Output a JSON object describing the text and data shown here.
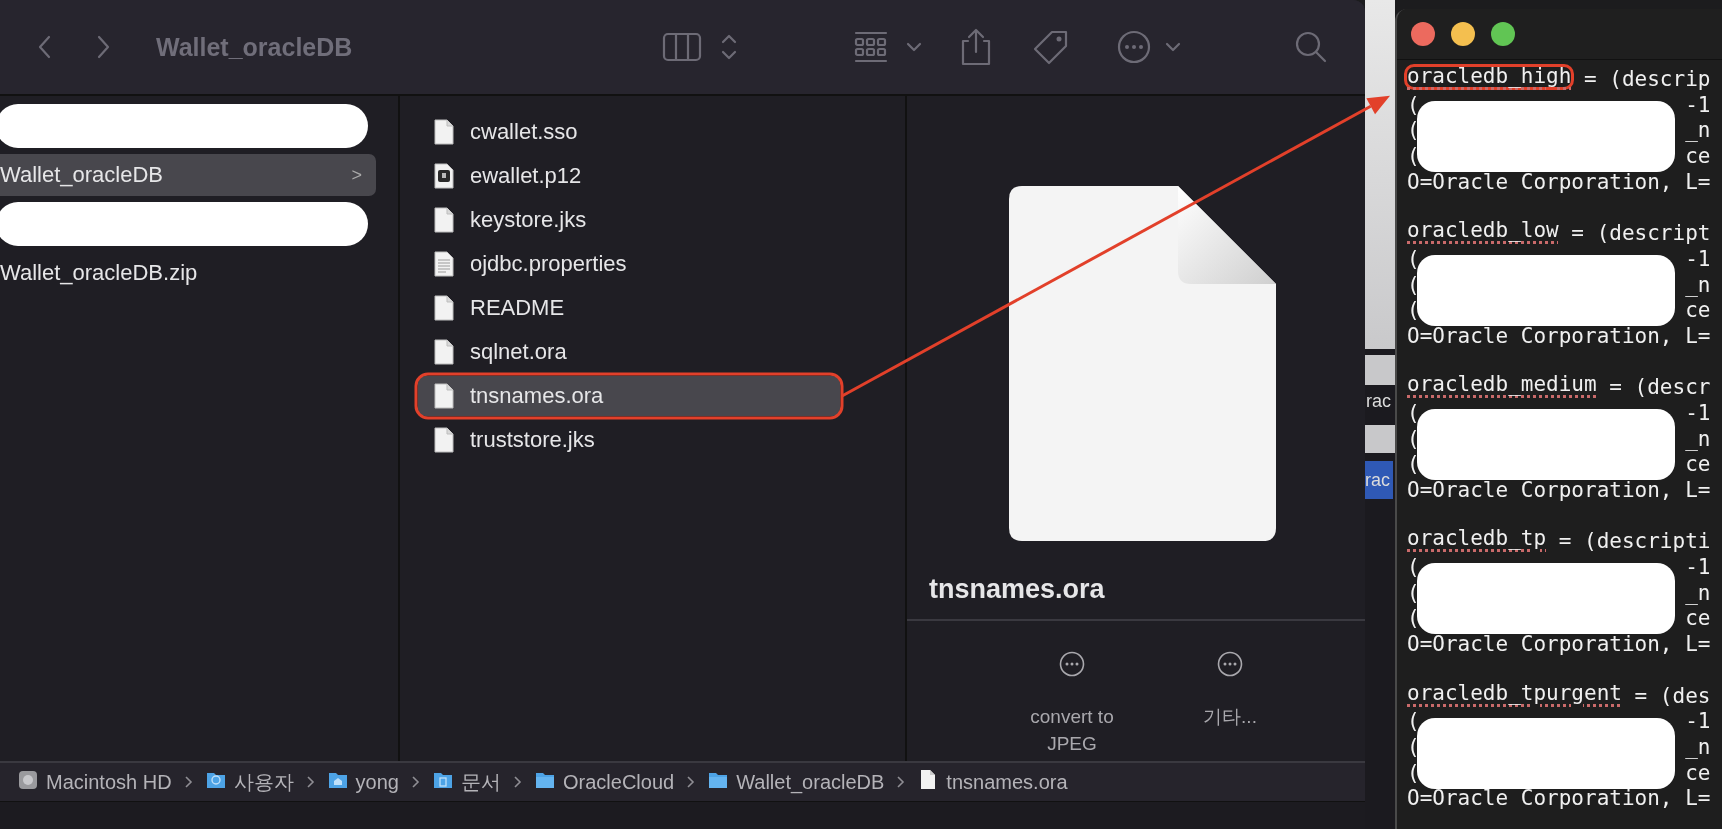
{
  "finder": {
    "title": "Wallet_oracleDB",
    "sidebar": {
      "items": [
        {
          "kind": "redacted"
        },
        {
          "kind": "folder",
          "label": "Wallet_oracleDB",
          "selected": true,
          "chevron": ">"
        },
        {
          "kind": "redacted"
        },
        {
          "kind": "file",
          "label": "Wallet_oracleDB.zip",
          "selected": false
        }
      ]
    },
    "files": [
      {
        "name": "cwallet.sso",
        "kind": "blank",
        "selected": false
      },
      {
        "name": "ewallet.p12",
        "kind": "certificate",
        "selected": false
      },
      {
        "name": "keystore.jks",
        "kind": "blank",
        "selected": false
      },
      {
        "name": "ojdbc.properties",
        "kind": "text",
        "selected": false
      },
      {
        "name": "README",
        "kind": "blank",
        "selected": false
      },
      {
        "name": "sqlnet.ora",
        "kind": "blank",
        "selected": false
      },
      {
        "name": "tnsnames.ora",
        "kind": "blank",
        "selected": true
      },
      {
        "name": "truststore.jks",
        "kind": "blank",
        "selected": false
      }
    ],
    "preview": {
      "filename": "tnsnames.ora",
      "actions": [
        {
          "label": "convert to JPEG"
        },
        {
          "label": "기타..."
        }
      ]
    },
    "path_bar": [
      {
        "label": "Macintosh HD",
        "kind": "disk"
      },
      {
        "label": "사용자",
        "kind": "users"
      },
      {
        "label": "yong",
        "kind": "home"
      },
      {
        "label": "문서",
        "kind": "documents"
      },
      {
        "label": "OracleCloud",
        "kind": "folder"
      },
      {
        "label": "Wallet_oracleDB",
        "kind": "folder"
      },
      {
        "label": "tnsnames.ora",
        "kind": "file"
      }
    ]
  },
  "background_window": {
    "texts": [
      {
        "text": "rac",
        "kind": "plain"
      },
      {
        "text": "rac",
        "kind": "highlighted"
      }
    ]
  },
  "editor": {
    "entries": [
      {
        "name": "oracledb_high",
        "rest": "= (descrip",
        "redacted": true,
        "lines": [
          {
            "head": "(",
            "tail": "-1"
          },
          {
            "head": "(",
            "tail": "_n"
          },
          {
            "head": "(",
            "tail": "ce"
          }
        ],
        "last": "O=Oracle Corporation, L="
      },
      {
        "name": "oracledb_low",
        "rest": "= (descript",
        "redacted": true,
        "lines": [
          {
            "head": "(",
            "tail": "-1"
          },
          {
            "head": "(",
            "tail": "_n"
          },
          {
            "head": "(",
            "tail": "ce"
          }
        ],
        "last": "O=Oracle Corporation, L="
      },
      {
        "name": "oracledb_medium",
        "rest": "= (descr",
        "redacted": true,
        "lines": [
          {
            "head": "(",
            "tail": "-1"
          },
          {
            "head": "(",
            "tail": "_n"
          },
          {
            "head": "(",
            "tail": "ce"
          }
        ],
        "last": "O=Oracle Corporation, L="
      },
      {
        "name": "oracledb_tp",
        "rest": "= (descripti",
        "redacted": true,
        "lines": [
          {
            "head": "(",
            "tail": "-1"
          },
          {
            "head": "(",
            "tail": "_n"
          },
          {
            "head": "(",
            "tail": "ce"
          }
        ],
        "last": "O=Oracle Corporation, L="
      },
      {
        "name": "oracledb_tpurgent",
        "rest": "= (des",
        "redacted": true,
        "lines": [
          {
            "head": "(",
            "tail": "-1"
          },
          {
            "head": "(",
            "tail": "_n"
          },
          {
            "head": "(",
            "tail": "ce"
          }
        ],
        "last": "O=Oracle Corporation, L="
      }
    ]
  },
  "annotations": [
    {
      "kind": "outline"
    },
    {
      "kind": "outline"
    },
    {
      "kind": "arrow"
    }
  ]
}
